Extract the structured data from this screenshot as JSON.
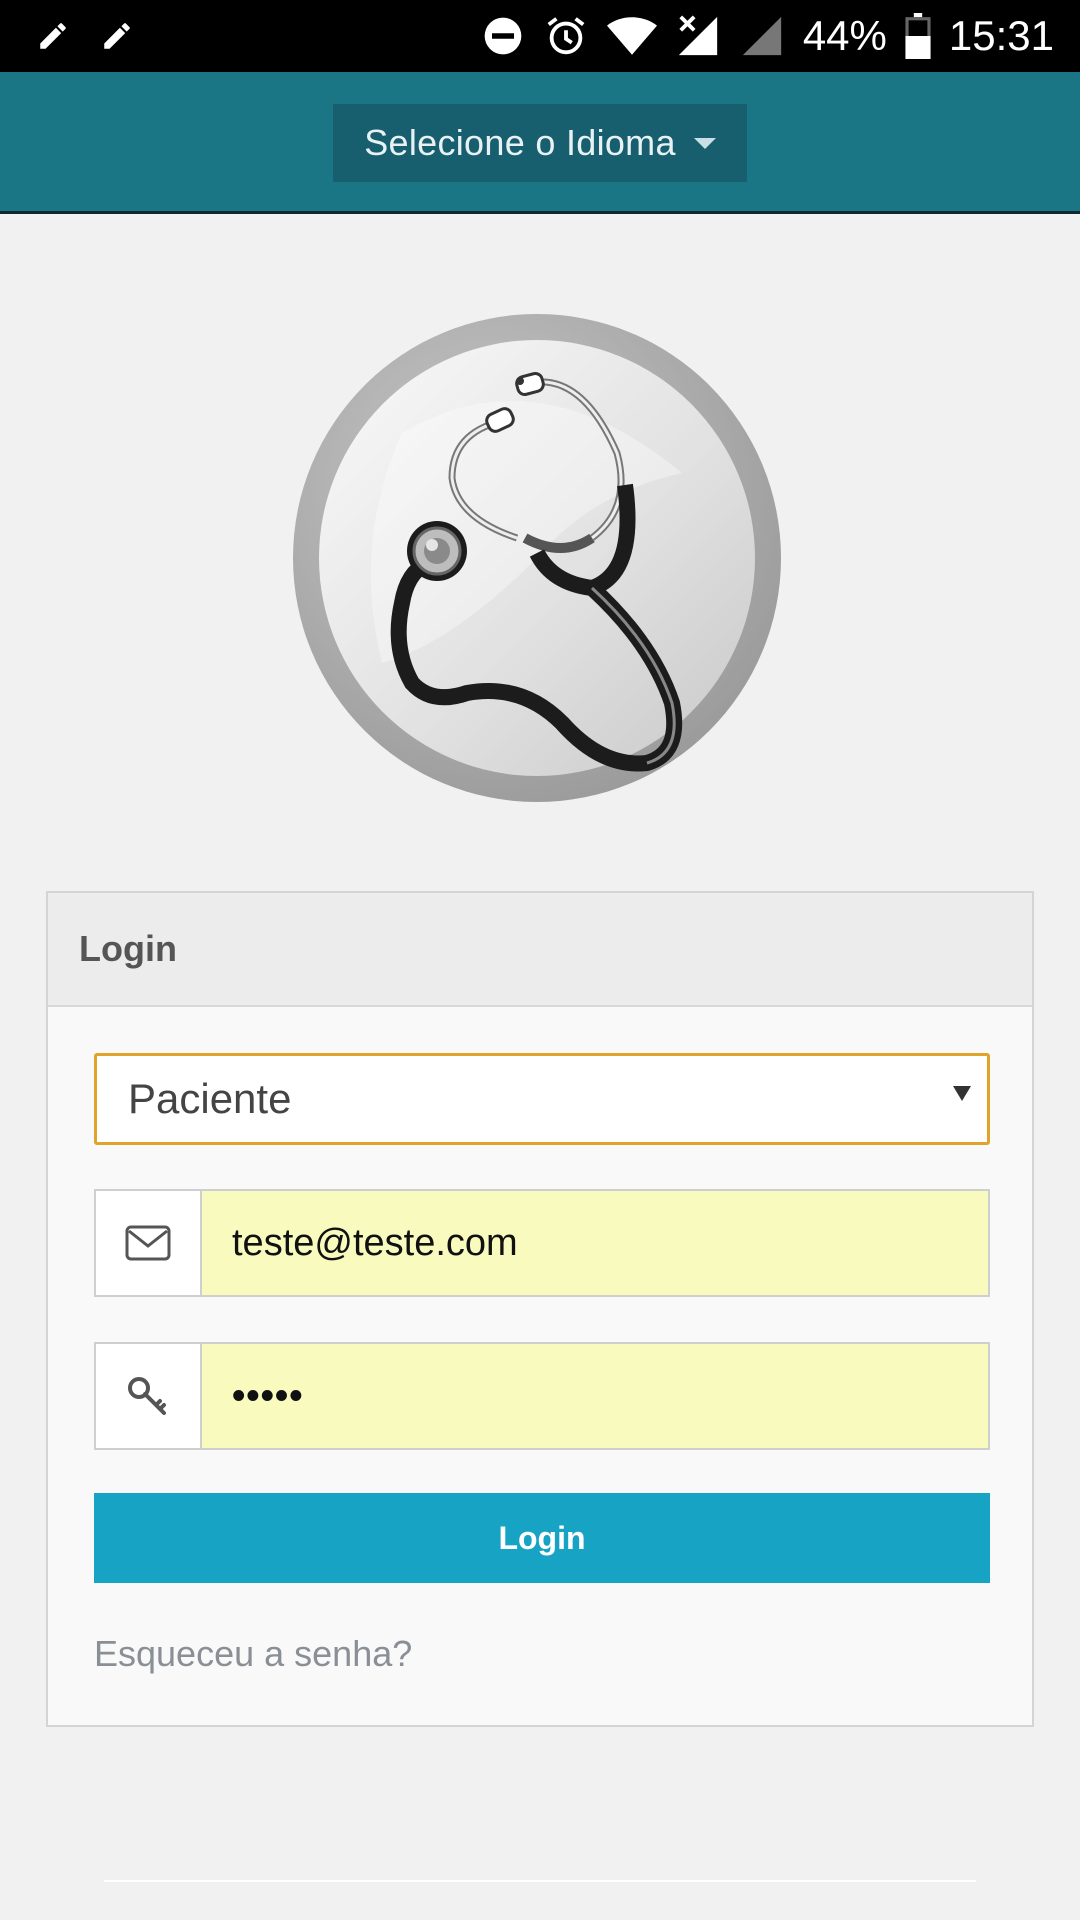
{
  "status_bar": {
    "left_icons": [
      "pencil-icon",
      "pencil-icon"
    ],
    "right_icons": [
      "do-not-disturb-icon",
      "alarm-icon",
      "wifi-icon",
      "signal-off-icon",
      "signal-icon"
    ],
    "battery": "44%",
    "time": "15:31"
  },
  "nav": {
    "language_label": "Selecione o Idioma"
  },
  "logo": {
    "icon": "stethoscope-icon"
  },
  "login_panel": {
    "heading": "Login",
    "user_type": {
      "selected": "Paciente"
    },
    "email": {
      "value": "teste@teste.com",
      "icon": "envelope-icon"
    },
    "password": {
      "value": "•••••",
      "icon": "key-icon"
    },
    "submit_label": "Login",
    "forgot_label": "Esqueceu a senha?"
  },
  "colors": {
    "nav_bg": "#1a7585",
    "button_bg": "#17a3c4",
    "select_border": "#e0a42b",
    "autofill_bg": "#f8fbbd"
  }
}
